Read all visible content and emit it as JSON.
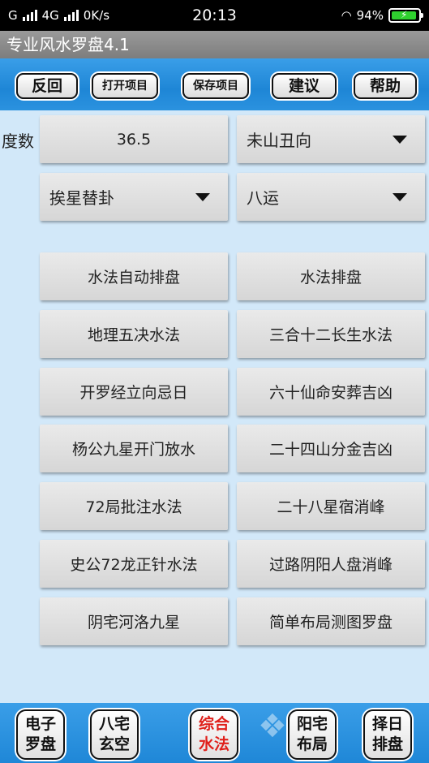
{
  "status": {
    "carrier": "G",
    "net": "4G",
    "speed": "0K/s",
    "time": "20:13",
    "battery": "94%"
  },
  "app": {
    "title": "专业风水罗盘4.1"
  },
  "toolbar": {
    "back": "反回",
    "open": "打开项目",
    "save": "保存项目",
    "suggest": "建议",
    "help": "帮助"
  },
  "degree": {
    "label": "度数",
    "value": "36.5",
    "direction": "未山丑向",
    "star_mode": "挨星替卦",
    "period": "八运"
  },
  "grid": [
    [
      "水法自动排盘",
      "水法排盘"
    ],
    [
      "地理五决水法",
      "三合十二长生水法"
    ],
    [
      "开罗经立向忌日",
      "六十仙命安葬吉凶"
    ],
    [
      "杨公九星开门放水",
      "二十四山分金吉凶"
    ],
    [
      "72局批注水法",
      "二十八星宿消峰"
    ],
    [
      "史公72龙正针水法",
      "过路阴阳人盘消峰"
    ],
    [
      "阴宅河洛九星",
      "简单布局测图罗盘"
    ]
  ],
  "bottom": [
    {
      "l1": "电子",
      "l2": "罗盘"
    },
    {
      "l1": "八宅",
      "l2": "玄空"
    },
    {
      "l1": "综合",
      "l2": "水法"
    },
    {
      "l1": "阳宅",
      "l2": "布局"
    },
    {
      "l1": "择日",
      "l2": "排盘"
    }
  ],
  "colors": {
    "accent": "#1e86d6",
    "background": "#d2e8f9",
    "active": "#e0201b"
  }
}
